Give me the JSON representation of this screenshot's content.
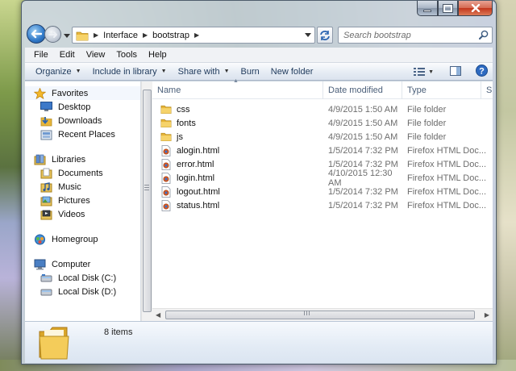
{
  "window": {
    "caption_buttons": [
      "minimize",
      "maximize",
      "close"
    ]
  },
  "address": {
    "crumbs": [
      "Interface",
      "bootstrap"
    ],
    "search_placeholder": "Search bootstrap"
  },
  "menu": {
    "items": [
      "File",
      "Edit",
      "View",
      "Tools",
      "Help"
    ]
  },
  "commands": {
    "organize": "Organize",
    "include_in_library": "Include in library",
    "share_with": "Share with",
    "burn": "Burn",
    "new_folder": "New folder"
  },
  "sidebar": {
    "favorites": {
      "label": "Favorites",
      "items": [
        "Desktop",
        "Downloads",
        "Recent Places"
      ]
    },
    "libraries": {
      "label": "Libraries",
      "items": [
        "Documents",
        "Music",
        "Pictures",
        "Videos"
      ]
    },
    "homegroup": {
      "label": "Homegroup"
    },
    "computer": {
      "label": "Computer",
      "items": [
        "Local Disk (C:)",
        "Local Disk (D:)"
      ]
    }
  },
  "columns": {
    "name": "Name",
    "date_modified": "Date modified",
    "type": "Type",
    "size": "Size"
  },
  "files": [
    {
      "name": "css",
      "date": "4/9/2015 1:50 AM",
      "type": "File folder",
      "icon": "folder-icon"
    },
    {
      "name": "fonts",
      "date": "4/9/2015 1:50 AM",
      "type": "File folder",
      "icon": "folder-icon"
    },
    {
      "name": "js",
      "date": "4/9/2015 1:50 AM",
      "type": "File folder",
      "icon": "folder-icon"
    },
    {
      "name": "alogin.html",
      "date": "1/5/2014 7:32 PM",
      "type": "Firefox HTML Doc...",
      "icon": "html-file-icon"
    },
    {
      "name": "error.html",
      "date": "1/5/2014 7:32 PM",
      "type": "Firefox HTML Doc...",
      "icon": "html-file-icon"
    },
    {
      "name": "login.html",
      "date": "4/10/2015 12:30 AM",
      "type": "Firefox HTML Doc...",
      "icon": "html-file-icon"
    },
    {
      "name": "logout.html",
      "date": "1/5/2014 7:32 PM",
      "type": "Firefox HTML Doc...",
      "icon": "html-file-icon"
    },
    {
      "name": "status.html",
      "date": "1/5/2014 7:32 PM",
      "type": "Firefox HTML Doc...",
      "icon": "html-file-icon"
    }
  ],
  "details": {
    "count": "8 items"
  },
  "colors": {
    "accent": "#1e395b",
    "folder_yellow": "#f2c94c",
    "secondary_text": "#6d6d6d"
  }
}
